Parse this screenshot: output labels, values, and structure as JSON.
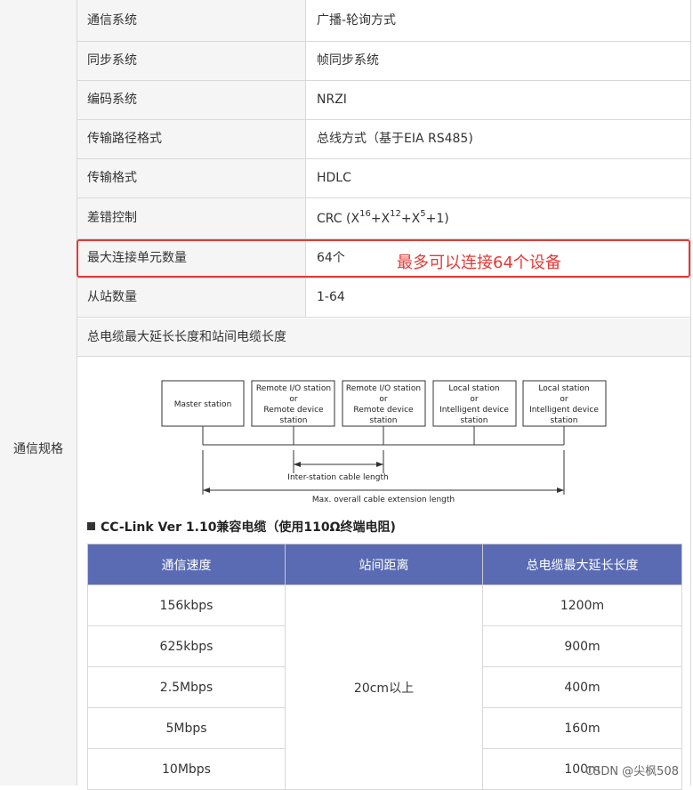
{
  "section_label": "通信规格",
  "rows": [
    {
      "key": "通信系统",
      "value": "广播-轮询方式"
    },
    {
      "key": "同步系统",
      "value": "帧同步系统"
    },
    {
      "key": "编码系统",
      "value": "NRZI"
    },
    {
      "key": "传输路径格式",
      "value": "总线方式（基于EIA RS485)"
    },
    {
      "key": "传输格式",
      "value": "HDLC"
    },
    {
      "key": "差错控制",
      "value": "CRC (X16+X12+X5+1)"
    },
    {
      "key": "最大连接单元数量",
      "value": "64个"
    },
    {
      "key": "从站数量",
      "value": "1-64"
    }
  ],
  "crc": {
    "prefix": "CRC (X",
    "e1": "16",
    "m1": "+X",
    "e2": "12",
    "m2": "+X",
    "e3": "5",
    "suffix": "+1)"
  },
  "annotation": "最多可以连接64个设备",
  "cable_length_heading": "总电缆最大延长长度和站间电缆长度",
  "diagram": {
    "stations": [
      [
        "Master station"
      ],
      [
        "Remote I/O station",
        "or",
        "Remote device",
        "station"
      ],
      [
        "Remote I/O station",
        "or",
        "Remote device",
        "station"
      ],
      [
        "Local station",
        "or",
        "Intelligent device",
        "station"
      ],
      [
        "Local station",
        "or",
        "Intelligent device",
        "station"
      ]
    ],
    "inter_station_label": "Inter-station cable length",
    "max_length_label": "Max. overall cable extension length"
  },
  "cable_table": {
    "title": "CC-Link Ver 1.10兼容电缆（使用110Ω终端电阻)",
    "headers": [
      "通信速度",
      "站间距离",
      "总电缆最大延长长度"
    ],
    "speeds": [
      "156kbps",
      "625kbps",
      "2.5Mbps",
      "5Mbps",
      "10Mbps"
    ],
    "station_distance": "20cm以上",
    "max_lengths": [
      "1200m",
      "900m",
      "400m",
      "160m",
      "100m"
    ]
  },
  "watermark": "CSDN @尖枫508",
  "colors": {
    "highlight": "#e53935",
    "table_header": "#5a6bb4"
  }
}
